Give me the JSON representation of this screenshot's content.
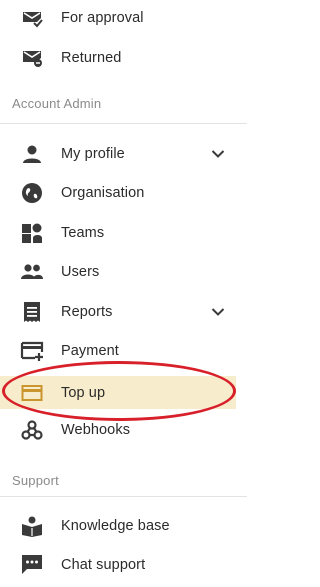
{
  "nav": {
    "for_approval": "For approval",
    "returned": "Returned"
  },
  "sections": {
    "account_admin": "Account Admin",
    "support": "Support"
  },
  "account_admin_items": {
    "my_profile": "My profile",
    "organisation": "Organisation",
    "teams": "Teams",
    "users": "Users",
    "reports": "Reports",
    "payment": "Payment",
    "top_up": "Top up",
    "webhooks": "Webhooks"
  },
  "support_items": {
    "knowledge_base": "Knowledge base",
    "chat_support": "Chat support"
  },
  "state": {
    "active_item": "Top up",
    "expandable_items": [
      "My profile",
      "Reports"
    ]
  },
  "colors": {
    "active_background": "#f7eccb",
    "highlight_ring": "#d8202a",
    "icon": "#3a3a3a",
    "top_up_icon": "#c9952c",
    "section_text": "#8a8a8a"
  },
  "icons": {
    "for_approval": "mail-check-icon",
    "returned": "mail-return-icon",
    "my_profile": "person-icon",
    "organisation": "globe-icon",
    "teams": "teams-icon",
    "users": "users-icon",
    "reports": "receipt-icon",
    "payment": "card-add-icon",
    "top_up": "card-icon",
    "webhooks": "webhook-icon",
    "knowledge_base": "book-reader-icon",
    "chat_support": "chat-icon",
    "expand": "chevron-down-icon"
  }
}
